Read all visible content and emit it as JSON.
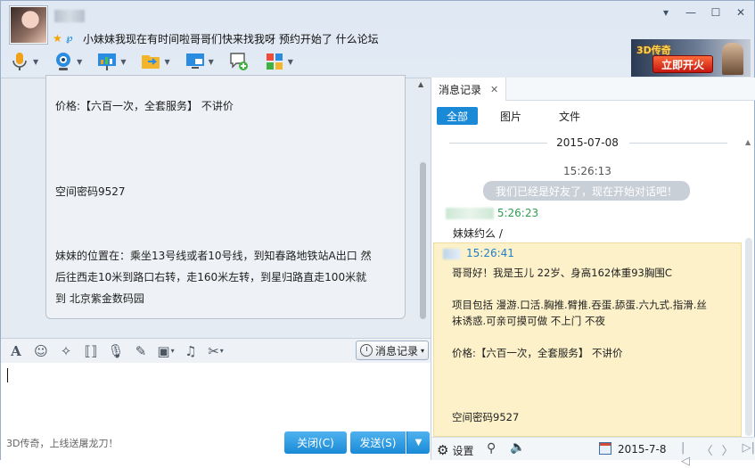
{
  "header": {
    "signature": "小妹妹我现在有时间啦哥哥们快来找我呀  预约开始了 什么论坛"
  },
  "window_controls": {
    "dropdown": "▾",
    "minimize": "—",
    "maximize": "☐",
    "close": "✕"
  },
  "ad": {
    "logo": "3D传奇",
    "button": "立即开火"
  },
  "chat": {
    "lines": [
      "价格:【六百一次，全套服务】 不讲价",
      "",
      "",
      "",
      "空间密码9527",
      "",
      "",
      "妹妹的位置在：乘坐13号线或者10号线，到知春路地铁站A出口 然",
      "后往西走10米到路口右转，走160米左转，到星归路直走100米就",
      "到 北京紫金数码园"
    ]
  },
  "format_bar": {
    "history_button": "消息记录"
  },
  "bottom": {
    "promo": "3D传奇，上线送屠龙刀！",
    "close_button": "关闭(C)",
    "send_button": "发送(S)"
  },
  "history": {
    "tab_label": "消息记录",
    "filters": [
      "全部",
      "图片",
      "文件"
    ],
    "date_header": "2015-07-08",
    "system_time": "15:26:13",
    "system_message": "我们已经是好友了，现在开始对话吧！",
    "msg1_time": "5:26:23",
    "msg1_text": "妹妹约么 /",
    "msg2_time": "15:26:41",
    "msg2_lines": [
      "哥哥好！我是玉儿 22岁、身高162体重93胸围C",
      "",
      "项目包括 漫游.口活.胸推.臂推.吞蛋.舔蛋.六九式.指滑.丝",
      "袜诱惑.可亲可摸可做      不上门  不夜",
      "",
      "价格:【六百一次，全套服务】 不讲价",
      "",
      "",
      "",
      "空间密码9527"
    ],
    "settings_label": "设置",
    "date_value": "2015-7-8"
  },
  "colors": {
    "accent": "#1a8ad7",
    "sender_green": "#2f9e4f",
    "highlight_bg": "#fcf1c9"
  }
}
